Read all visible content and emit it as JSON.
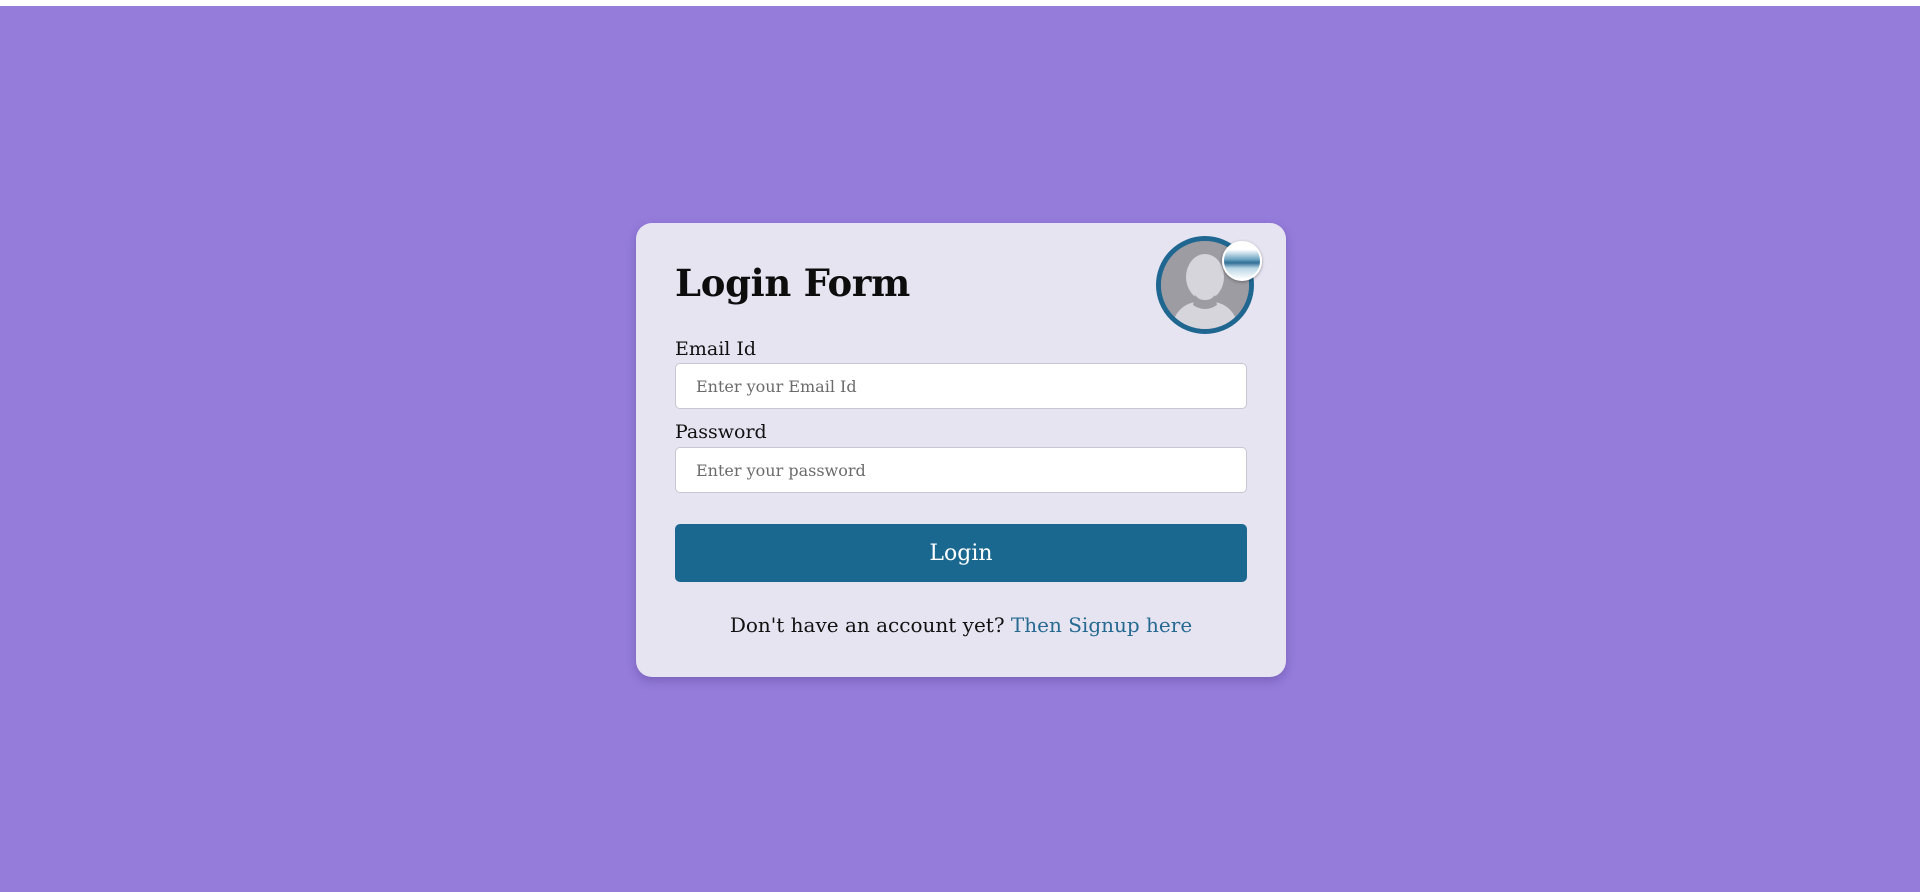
{
  "form": {
    "title": "Login Form",
    "email_label": "Email Id",
    "email_placeholder": "Enter your Email Id",
    "email_value": "",
    "password_label": "Password",
    "password_placeholder": "Enter your password",
    "password_value": "",
    "login_label": "Login",
    "signup_prompt": "Don't have an account yet? ",
    "signup_link": "Then Signup here"
  },
  "avatar": {
    "icon": "user-silhouette-icon",
    "upload_icon": "upload-photo-icon"
  },
  "colors": {
    "page_background": "#957cdb",
    "card_background": "#e7e4f1",
    "accent": "#1a6890",
    "link": "#266a92"
  }
}
